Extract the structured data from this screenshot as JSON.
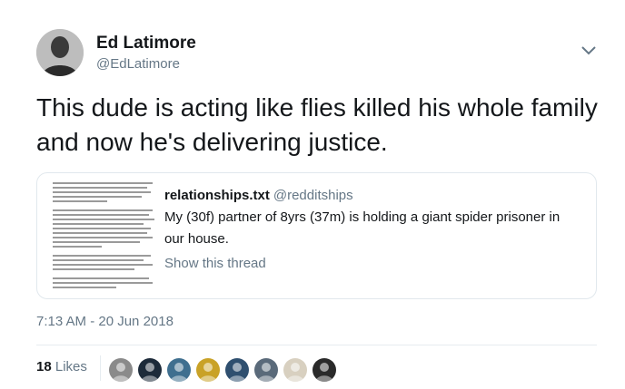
{
  "author": {
    "name": "Ed Latimore",
    "handle": "@EdLatimore"
  },
  "tweet": {
    "text": "This dude is acting like flies killed his whole family and now he's delivering justice."
  },
  "quoted": {
    "name": "relationships.txt",
    "handle": "@redditships",
    "text": "My (30f) partner of 8yrs (37m) is holding a giant spider prisoner in our house.",
    "link_label": "Show this thread"
  },
  "meta": {
    "timestamp": "7:13 AM - 20 Jun 2018"
  },
  "stats": {
    "likes_count": "18",
    "likes_label": "Likes"
  },
  "likers": [
    {
      "icon": "avatar-icon",
      "color": "#8a8a8a"
    },
    {
      "icon": "avatar-icon",
      "color": "#1d2b3a"
    },
    {
      "icon": "avatar-icon",
      "color": "#3f6f8f"
    },
    {
      "icon": "avatar-icon",
      "color": "#c9a227"
    },
    {
      "icon": "avatar-icon",
      "color": "#2f4f6f"
    },
    {
      "icon": "avatar-icon",
      "color": "#5a6a7a"
    },
    {
      "icon": "avatar-icon",
      "color": "#d8d0c0"
    },
    {
      "icon": "avatar-icon",
      "color": "#2a2a2a"
    }
  ],
  "colors": {
    "text": "#14171a",
    "secondary": "#657786",
    "border": "#e1e8ed"
  }
}
